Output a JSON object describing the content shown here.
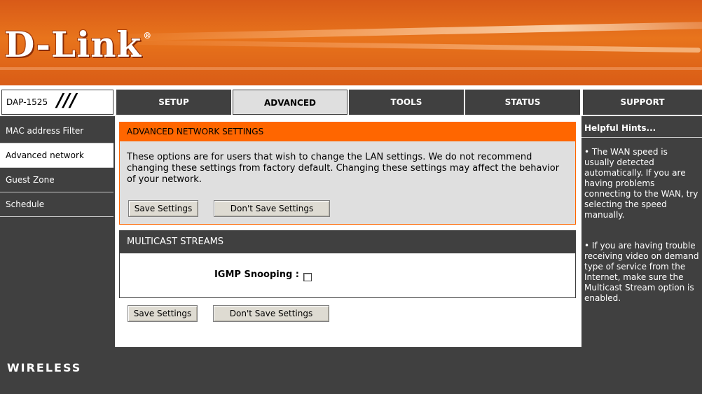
{
  "brand": {
    "logo": "D-Link",
    "reg": "®",
    "model": "DAP-1525"
  },
  "nav": {
    "tabs": [
      {
        "label": "SETUP"
      },
      {
        "label": "ADVANCED"
      },
      {
        "label": "TOOLS"
      },
      {
        "label": "STATUS"
      },
      {
        "label": "SUPPORT"
      }
    ],
    "active_tab": "ADVANCED"
  },
  "sidebar": {
    "items": [
      {
        "label": "MAC address Filter"
      },
      {
        "label": "Advanced network"
      },
      {
        "label": "Guest Zone"
      },
      {
        "label": "Schedule"
      }
    ],
    "active_item": "Advanced network"
  },
  "advanced_network": {
    "title": "ADVANCED NETWORK SETTINGS",
    "description": "These options are for users that wish to change the LAN settings. We do not recommend changing these settings from factory default. Changing these settings may affect the behavior of your network.",
    "save_label": "Save Settings",
    "dont_save_label": "Don't Save Settings"
  },
  "multicast": {
    "title": "MULTICAST STREAMS",
    "igmp_label": "IGMP Snooping :",
    "igmp_checked": false
  },
  "bottom_buttons": {
    "save_label": "Save Settings",
    "dont_save_label": "Don't Save Settings"
  },
  "hints": {
    "title": "Helpful Hints...",
    "items": [
      "• The WAN speed is usually detected automatically. If you are having problems connecting to the WAN, try selecting the speed manually.",
      "• If you are having trouble receiving video on demand type of service from the Internet, make sure the Multicast Stream option is enabled."
    ]
  },
  "footer": {
    "label": "WIRELESS"
  },
  "colors": {
    "accent": "#ff6600",
    "dark": "#404040",
    "panel": "#dfdfdf"
  }
}
